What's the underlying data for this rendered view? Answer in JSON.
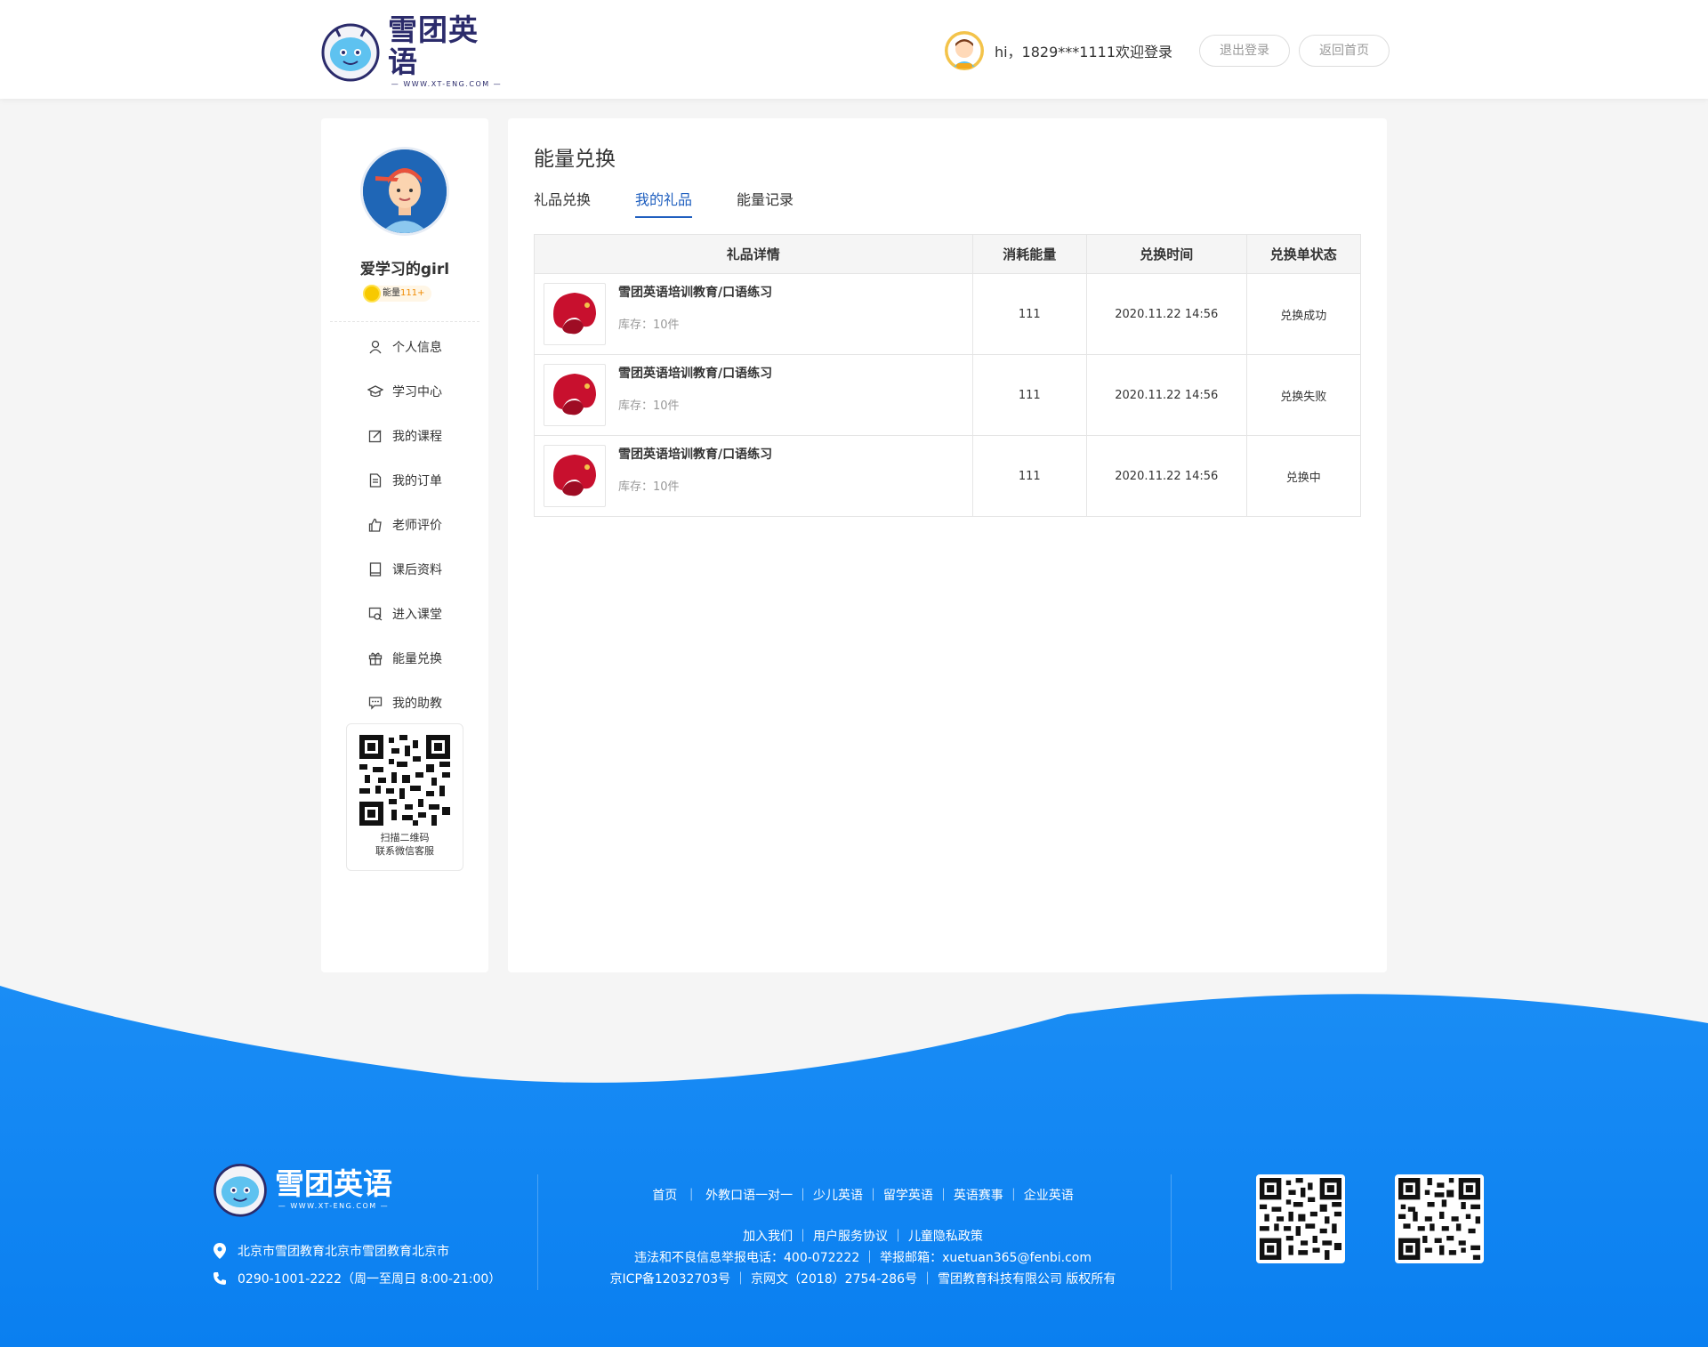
{
  "header": {
    "logo_cn": "雪团英语",
    "logo_en": "— WWW.XT-ENG.COM —",
    "greeting": "hi，1829***1111欢迎登录",
    "logout_label": "退出登录",
    "home_label": "返回首页"
  },
  "sidebar": {
    "username": "爱学习的girl",
    "energy_label": "能量",
    "energy_value": "111+",
    "menu": [
      {
        "label": "个人信息",
        "icon": "user-icon"
      },
      {
        "label": "学习中心",
        "icon": "graduation-cap-icon"
      },
      {
        "label": "我的课程",
        "icon": "edit-icon"
      },
      {
        "label": "我的订单",
        "icon": "document-icon"
      },
      {
        "label": "老师评价",
        "icon": "thumbs-up-icon"
      },
      {
        "label": "课后资料",
        "icon": "book-icon"
      },
      {
        "label": "进入课堂",
        "icon": "classroom-icon"
      },
      {
        "label": "能量兑换",
        "icon": "gift-icon"
      },
      {
        "label": "我的助教",
        "icon": "chat-icon"
      }
    ],
    "qr_text_1": "扫描二维码",
    "qr_text_2": "联系微信客服"
  },
  "main": {
    "title": "能量兑换",
    "tabs": [
      {
        "label": "礼品兑换",
        "active": false
      },
      {
        "label": "我的礼品",
        "active": true
      },
      {
        "label": "能量记录",
        "active": false
      }
    ],
    "table": {
      "headers": [
        "礼品详情",
        "消耗能量",
        "兑换时间",
        "兑换单状态"
      ],
      "rows": [
        {
          "name": "雪团英语培训教育/口语练习",
          "stock": "库存：10件",
          "energy": "111",
          "time": "2020.11.22  14:56",
          "status": "兑换成功",
          "status_type": "ok"
        },
        {
          "name": "雪团英语培训教育/口语练习",
          "stock": "库存：10件",
          "energy": "111",
          "time": "2020.11.22  14:56",
          "status": "兑换失败",
          "status_type": "fail"
        },
        {
          "name": "雪团英语培训教育/口语练习",
          "stock": "库存：10件",
          "energy": "111",
          "time": "2020.11.22  14:56",
          "status": "兑换中",
          "status_type": "pending"
        }
      ]
    }
  },
  "footer": {
    "logo_cn": "雪团英语",
    "logo_en": "— WWW.XT-ENG.COM —",
    "address": "北京市雪团教育北京市雪团教育北京市",
    "phone": "0290-1001-2222（周一至周日 8:00-21:00）",
    "nav_1": [
      "首页",
      "外教口语一对一",
      "少儿英语",
      "留学英语",
      "英语赛事",
      "企业英语"
    ],
    "nav_2": [
      "加入我们",
      "用户服务协议",
      "儿童隐私政策"
    ],
    "report_line": "违法和不良信息举报电话：400-072222 ｜ 举报邮箱：xuetuan365@fenbi.com",
    "icp_line": "京ICP备12032703号 ｜ 京网文（2018）2754-286号 ｜ 雪团教育科技有限公司 版权所有"
  },
  "colors": {
    "primary": "#1f5fbf",
    "footer_blue": "#0a7ff0",
    "status_ok": "#1aad19",
    "status_fail": "#e02020",
    "status_pending": "#f08a00"
  }
}
